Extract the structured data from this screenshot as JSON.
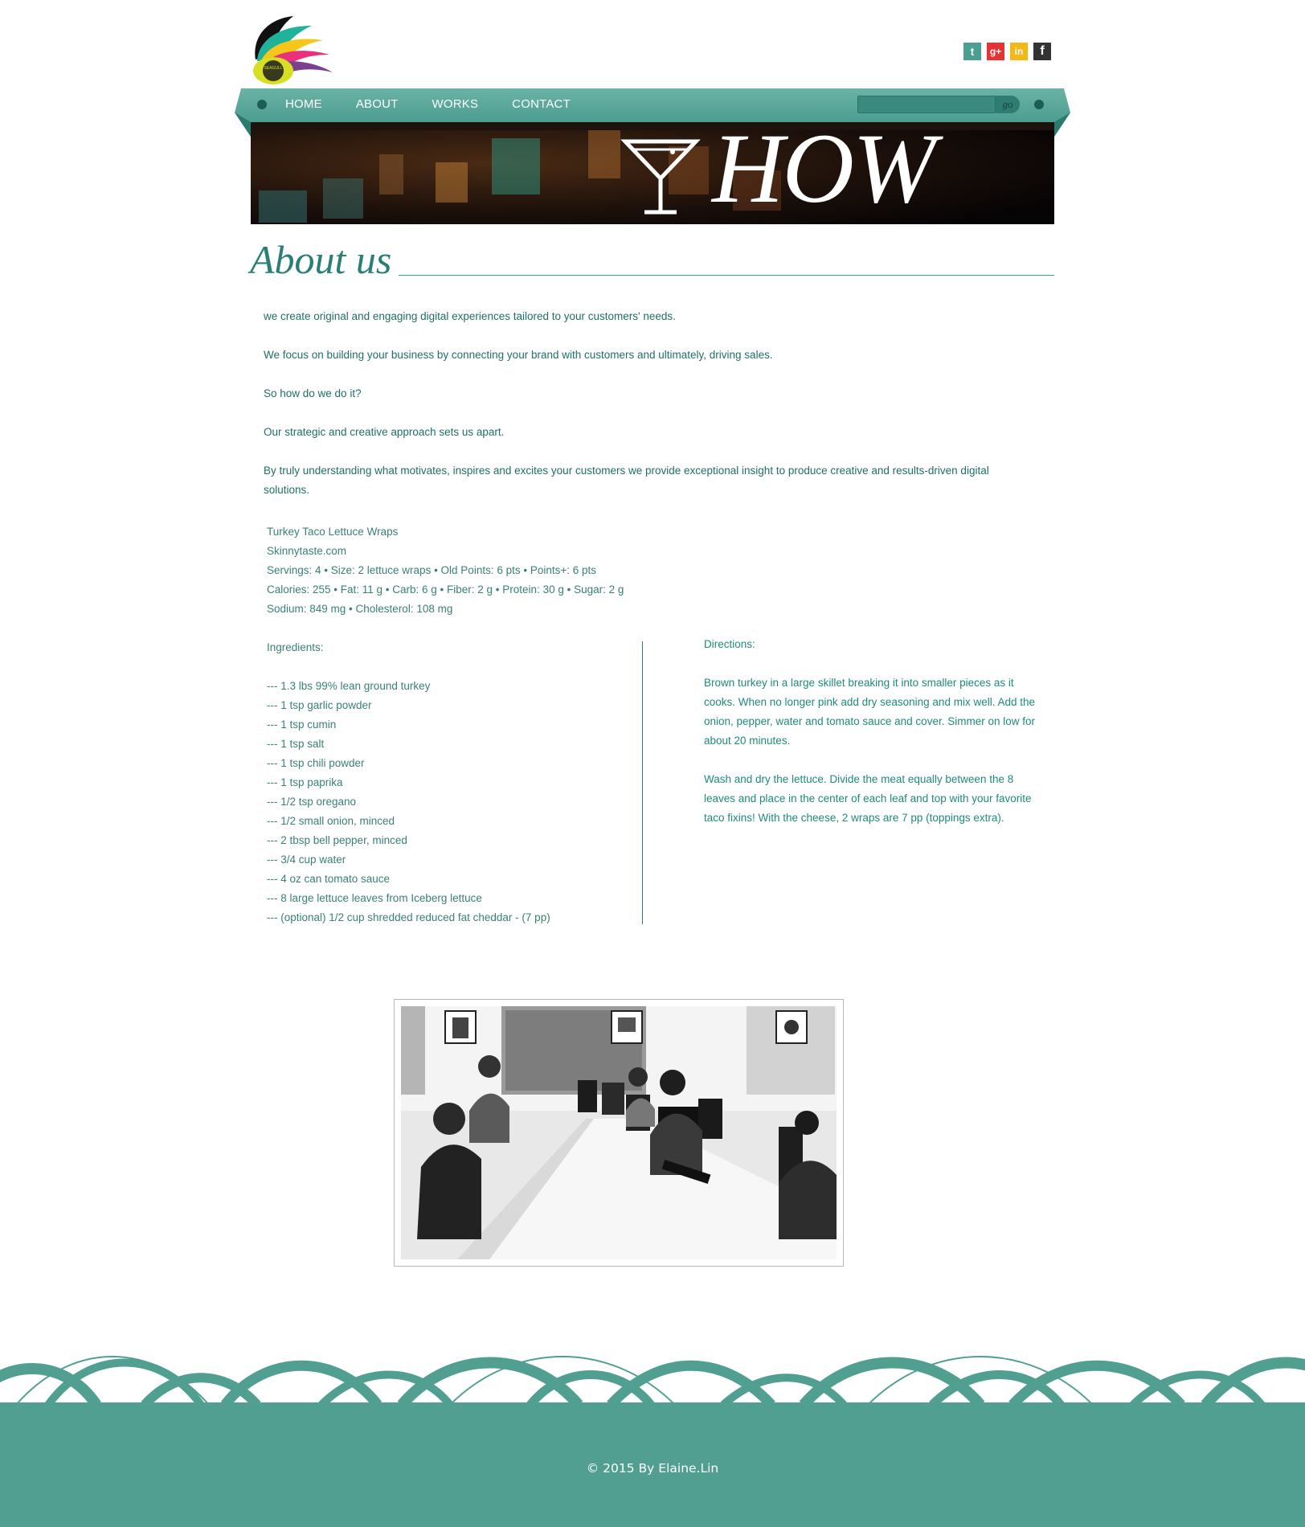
{
  "logo": {
    "text": "SEAGULL"
  },
  "social": [
    {
      "name": "twitter",
      "glyph": "t"
    },
    {
      "name": "google-plus",
      "glyph": "g+"
    },
    {
      "name": "linkedin",
      "glyph": "in"
    },
    {
      "name": "facebook",
      "glyph": "f"
    }
  ],
  "nav": {
    "items": [
      "HOME",
      "ABOUT",
      "WORKS",
      "CONTACT"
    ],
    "search_placeholder": "",
    "go_label": "go"
  },
  "banner": {
    "title": "HOW"
  },
  "about": {
    "heading": "About us",
    "paragraphs": [
      "we create original and engaging digital experiences tailored to your customers' needs.",
      "We focus on building your business by connecting your brand with customers and ultimately, driving sales.",
      "So how do we do it?",
      "Our strategic and creative approach sets us apart.",
      "By truly understanding what motivates, inspires and excites your customers we provide exceptional insight to produce creative and results-driven digital solutions."
    ]
  },
  "recipe": {
    "lines": [
      "Turkey Taco Lettuce Wraps",
      "Skinnytaste.com",
      "Servings: 4 • Size: 2 lettuce wraps • Old Points: 6 pts • Points+: 6 pts",
      "Calories: 255 • Fat: 11 g • Carb: 6 g • Fiber: 2 g • Protein: 30 g • Sugar: 2 g",
      "Sodium: 849 mg • Cholesterol: 108 mg"
    ],
    "ingredients_title": "Ingredients:",
    "ingredients": [
      "--- 1.3 lbs 99% lean ground turkey",
      "--- 1 tsp garlic powder",
      "--- 1 tsp cumin",
      "--- 1 tsp salt",
      "--- 1 tsp chili powder",
      "--- 1 tsp paprika",
      "--- 1/2 tsp oregano",
      "--- 1/2 small onion, minced",
      "--- 2 tbsp bell pepper, minced",
      "--- 3/4 cup water",
      "--- 4 oz can tomato sauce",
      "--- 8 large lettuce leaves from Iceberg lettuce",
      "--- (optional) 1/2 cup shredded reduced fat cheddar - (7 pp)"
    ],
    "directions_title": "Directions:",
    "directions": [
      "Brown turkey in a large skillet breaking it into smaller pieces as it cooks. When no longer pink add dry seasoning and mix well. Add the onion, pepper, water and tomato sauce and cover. Simmer on low for about 20 minutes.",
      "Wash and dry the lettuce. Divide the meat equally between the 8 leaves and place in the center of each leaf and top with your favorite taco fixins! With the cheese, 2 wraps are 7 pp (toppings extra)."
    ]
  },
  "footer": {
    "copyright": "© 2015 By Elaine.Lin"
  },
  "colors": {
    "teal": "#519f90",
    "text": "#1f6f66",
    "nav": "#4a9e92"
  }
}
